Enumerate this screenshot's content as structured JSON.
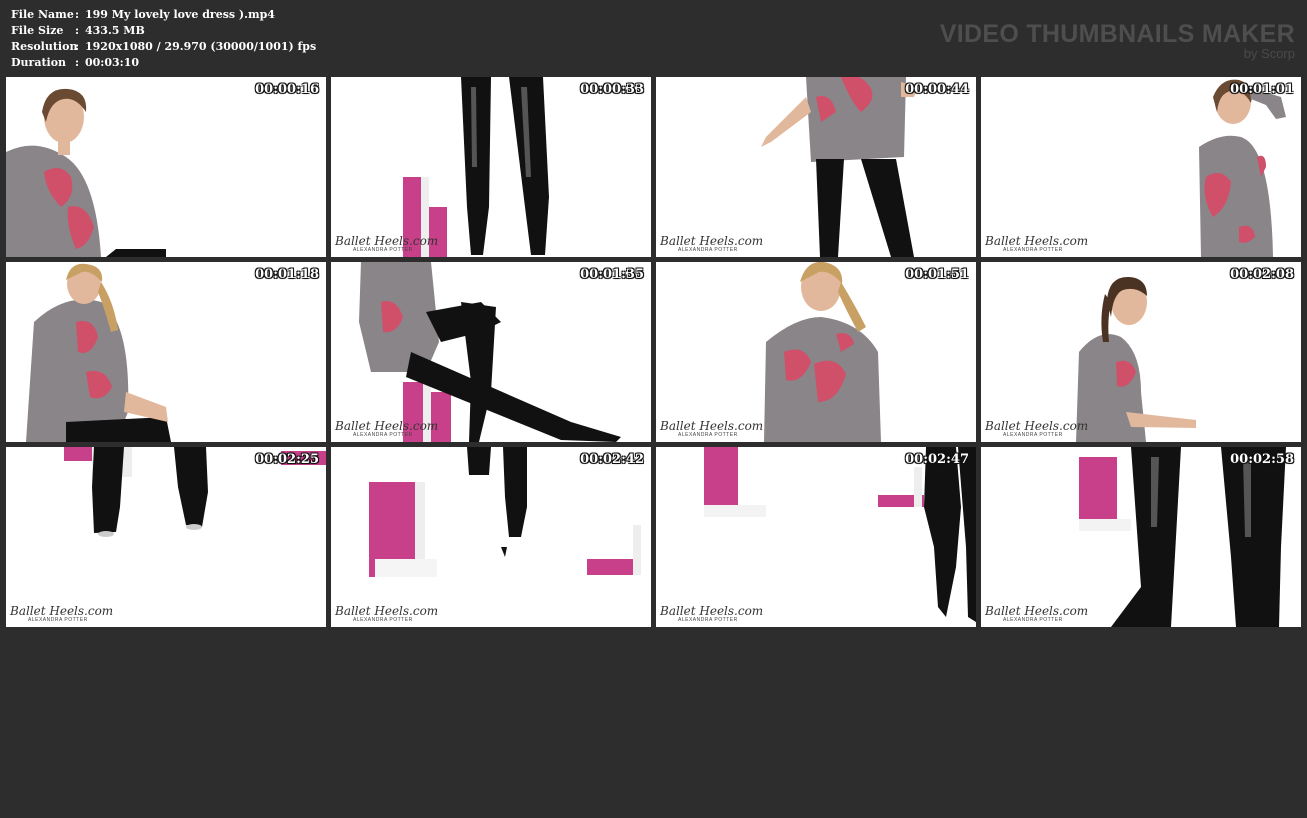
{
  "info": {
    "rows": [
      {
        "key": "File Name",
        "sep": ":",
        "value": "199 My lovely love dress ).mp4"
      },
      {
        "key": "File Size",
        "sep": ":",
        "value": "433.5 MB"
      },
      {
        "key": "Resolution",
        "sep": ":",
        "value": "1920x1080 / 29.970 (30000/1001) fps"
      },
      {
        "key": "Duration",
        "sep": ":",
        "value": "00:03:10"
      }
    ]
  },
  "brand": {
    "title": "VIDEO THUMBNAILS MAKER",
    "byline": "by Scorp"
  },
  "watermark": {
    "main": "Ballet Heels.com",
    "sub": "ALEXANDRA POTTER"
  },
  "colors": {
    "background": "#2d2d2d",
    "brand_text": "#4e4e4e",
    "sweater": "#8a8588",
    "heart": "#d0506a",
    "latex": "#111111",
    "shelf": "#c8408a"
  },
  "thumbnails": [
    {
      "time": "00:00:16",
      "scene": "woman-closeup-left"
    },
    {
      "time": "00:00:33",
      "scene": "latex-legs-shelf"
    },
    {
      "time": "00:00:44",
      "scene": "sweater-torso-legs"
    },
    {
      "time": "00:01:01",
      "scene": "woman-right-pose"
    },
    {
      "time": "00:01:18",
      "scene": "woman-seated-left"
    },
    {
      "time": "00:01:35",
      "scene": "seated-legs-extended"
    },
    {
      "time": "00:01:51",
      "scene": "woman-center-smile"
    },
    {
      "time": "00:02:08",
      "scene": "woman-profile-table"
    },
    {
      "time": "00:02:25",
      "scene": "boots-closeup"
    },
    {
      "time": "00:02:42",
      "scene": "boot-shelf"
    },
    {
      "time": "00:02:47",
      "scene": "boots-right-shelf"
    },
    {
      "time": "00:02:58",
      "scene": "boots-legs-closeup"
    }
  ]
}
